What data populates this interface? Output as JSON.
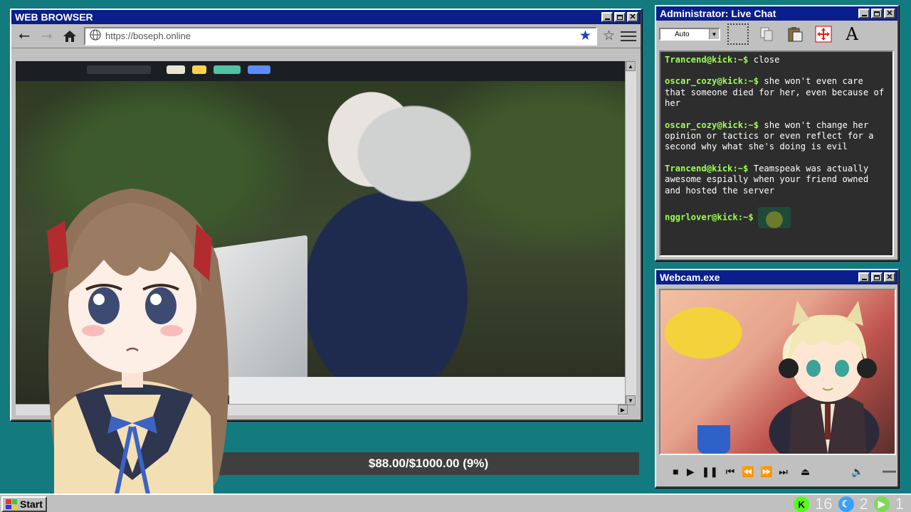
{
  "browser": {
    "title": "WEB BROWSER",
    "url": "https://boseph.online",
    "icons": [
      "back-arrow-icon",
      "forward-arrow-icon",
      "home-icon",
      "globe-icon",
      "bookmark-star-filled-icon",
      "bookmark-star-outline-icon",
      "hamburger-menu-icon"
    ]
  },
  "donation": {
    "text": "$88.00/$1000.00 (9%)",
    "current": 88.0,
    "goal": 1000.0,
    "percent": 9
  },
  "chat": {
    "title": "Administrator: Live Chat",
    "dropdown": "Auto",
    "tools": [
      "select-tool-icon",
      "copy-icon",
      "paste-icon",
      "move-icon",
      "text-icon"
    ],
    "text_tool": "A",
    "messages": [
      {
        "user": "Trancend@kick:~$",
        "text": " close"
      },
      {
        "user": "oscar_cozy@kick:~$",
        "text": " she won't even care that someone died for her, even because of her"
      },
      {
        "user": "oscar_cozy@kick:~$",
        "text": " she won't change her opinion or tactics or even reflect for a second why what she's doing is evil"
      },
      {
        "user": "Trancend@kick:~$",
        "text": " Teamspeak was actually awesome espially when your friend owned and hosted the server"
      },
      {
        "user": "nggrlover@kick:~$",
        "text": ""
      }
    ]
  },
  "webcam": {
    "title": "Webcam.exe",
    "controls": [
      "stop-icon",
      "play-icon",
      "pause-icon",
      "skip-start-icon",
      "rewind-icon",
      "fast-forward-icon",
      "skip-end-icon",
      "eject-icon",
      "volume-icon"
    ]
  },
  "taskbar": {
    "start_label": "Start",
    "tray": [
      {
        "icon": "kick-icon",
        "value": "16",
        "color": "#53fc18"
      },
      {
        "icon": "moon-icon",
        "value": "2",
        "color": "#3aa0ff"
      },
      {
        "icon": "play-circle-icon",
        "value": "1",
        "color": "#7ed957"
      }
    ]
  },
  "colors": {
    "desktop": "#137a7f",
    "titlebar": "#0a1e8c",
    "chat_user": "#9cff52",
    "progress_bg": "#3f3f3f"
  }
}
